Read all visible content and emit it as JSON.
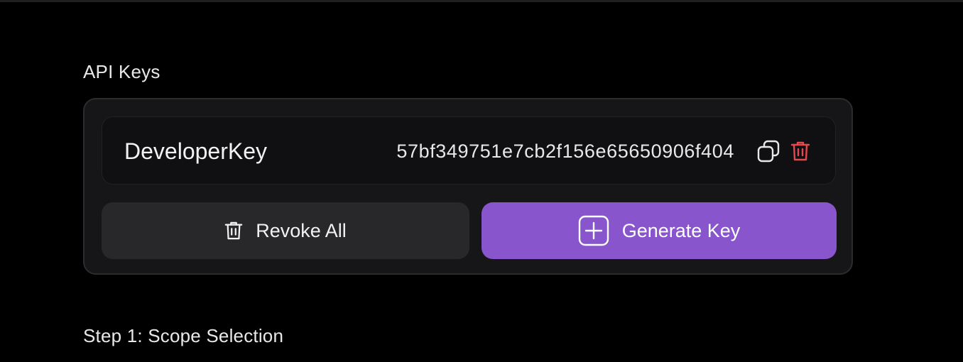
{
  "api_keys": {
    "title": "API Keys",
    "keys": [
      {
        "name": "DeveloperKey",
        "value": "57bf349751e7cb2f156e65650906f404",
        "icons": [
          "copy-icon",
          "trash-icon"
        ]
      }
    ],
    "revoke_all_label": "Revoke All",
    "generate_key_label": "Generate Key"
  },
  "step1": {
    "title": "Step 1: Scope Selection"
  },
  "colors": {
    "background": "#000000",
    "panel": "#161618",
    "accent": "#8955cc",
    "danger": "#e5484d"
  }
}
